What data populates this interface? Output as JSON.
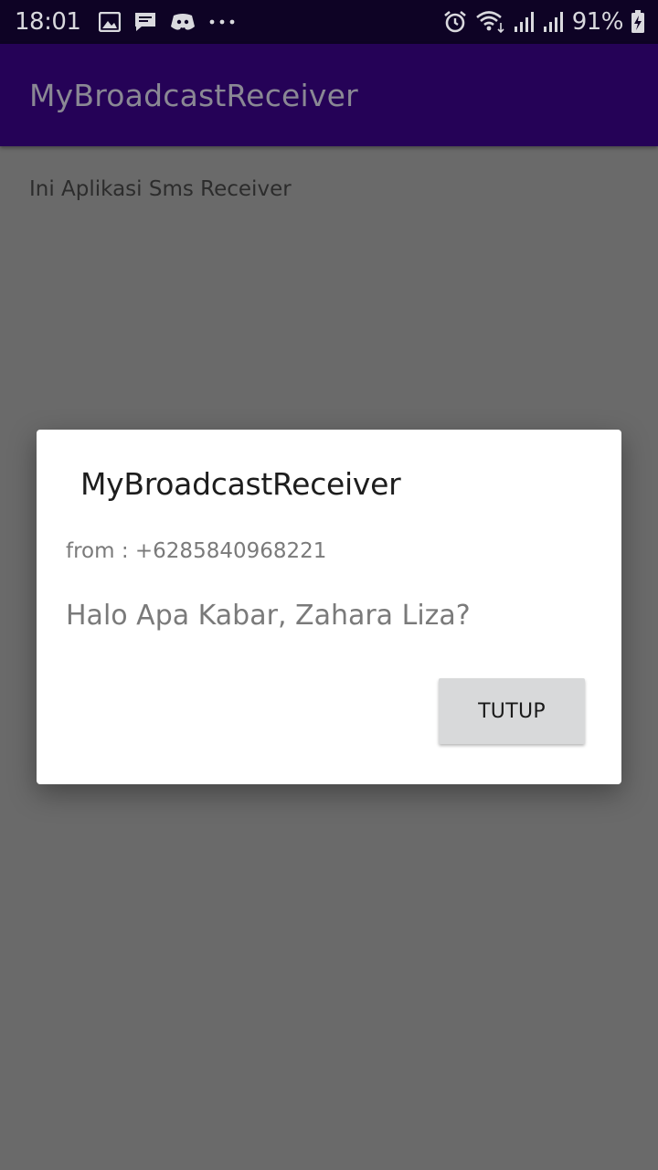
{
  "status_bar": {
    "time": "18:01",
    "battery_percent": "91%",
    "left_icons": [
      "image-icon",
      "message-icon",
      "discord-icon",
      "more-dots-icon"
    ],
    "right_icons": [
      "alarm-icon",
      "wifi-icon",
      "signal-icon",
      "signal-icon",
      "battery-charging-icon"
    ]
  },
  "app_bar": {
    "title": "MyBroadcastReceiver",
    "background": "#250257"
  },
  "content": {
    "text": "Ini Aplikasi Sms Receiver"
  },
  "dialog": {
    "title": "MyBroadcastReceiver",
    "from": "from : +6285840968221",
    "message": "Halo Apa Kabar, Zahara Liza?",
    "button_label": "TUTUP"
  }
}
